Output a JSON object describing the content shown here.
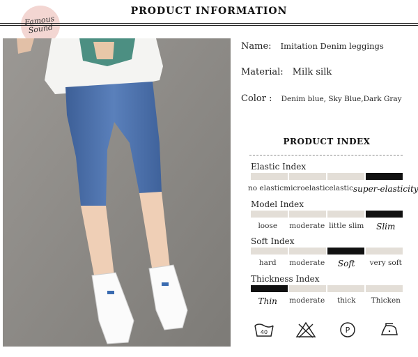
{
  "brand": {
    "logo_text_line1": "Famous",
    "logo_text_line2": "Sound"
  },
  "header": {
    "title": "PRODUCT INFORMATION"
  },
  "info": {
    "name_label": "Name:",
    "name_value": "Imitation Denim leggings",
    "material_label": "Material:",
    "material_value": "Milk silk",
    "color_label": "Color :",
    "color_value": "Denim blue, Sky Blue,Dark Gray"
  },
  "product_index": {
    "title": "PRODUCT INDEX",
    "indices": [
      {
        "label": "Elastic Index",
        "options": [
          "no elastic",
          "microelastic",
          "elastic",
          "super-elasticity"
        ],
        "active": 3
      },
      {
        "label": "Model Index",
        "options": [
          "loose",
          "moderate",
          "little slim",
          "Slim"
        ],
        "active": 3
      },
      {
        "label": "Soft Index",
        "options": [
          "hard",
          "moderate",
          "Soft",
          "very soft"
        ],
        "active": 2
      },
      {
        "label": "Thickness Index",
        "options": [
          "Thin",
          "moderate",
          "thick",
          "Thicken"
        ],
        "active": 0
      }
    ]
  },
  "care_icons": [
    "wash-40-icon",
    "do-not-bleach-icon",
    "professional-dry-clean-icon",
    "iron-icon"
  ],
  "care_text": {
    "wash_temp": "40",
    "dry_clean_letter": "P"
  },
  "colors": {
    "denim": "#4a6fa8",
    "active_bar": "#111111",
    "inactive_bar": "#e3ded7",
    "floor": "#8e8c88"
  }
}
